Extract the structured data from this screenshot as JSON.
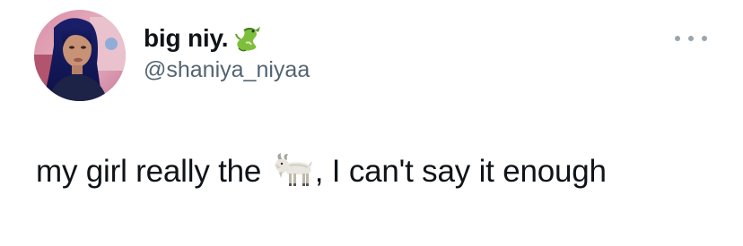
{
  "tweet": {
    "author": {
      "display_name": "big niy.",
      "name_emoji": "dragon-emoji",
      "handle": "@shaniya_niyaa"
    },
    "text_before_emoji": "my girl really the ",
    "inline_emoji": "goat-emoji",
    "text_after_emoji": ", I can't say it enough",
    "more_icon": "more-horizontal-icon"
  }
}
